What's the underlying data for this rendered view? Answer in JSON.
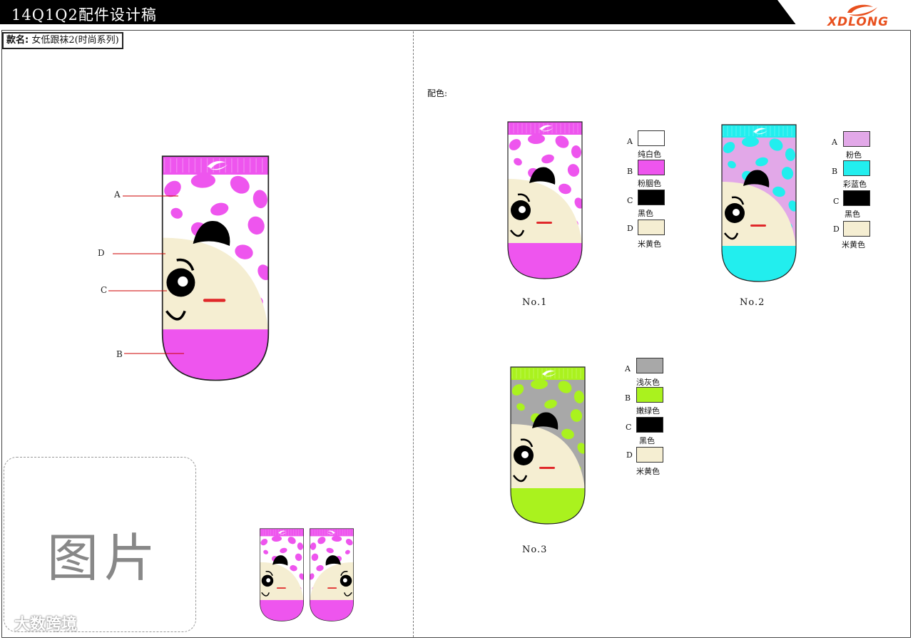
{
  "header": {
    "title": "14Q1Q2配件设计稿",
    "logo_text": "XDLONG",
    "bar_color": "#000000",
    "logo_color": "#e8501e"
  },
  "style": {
    "label": "款名:",
    "name": "女低跟袜2(时尚系列)"
  },
  "main_sock": {
    "callouts": [
      "A",
      "D",
      "C",
      "B"
    ]
  },
  "photo": {
    "placeholder_text": "图片"
  },
  "watermark": "大数跨境",
  "palette": {
    "label": "配色:",
    "colorways": [
      {
        "number": "No.1",
        "swatches": [
          {
            "letter": "A",
            "name": "纯白色",
            "color": "#ffffff"
          },
          {
            "letter": "B",
            "name": "粉胭色",
            "color": "#ee55ee"
          },
          {
            "letter": "C",
            "name": "黑色",
            "color": "#000000"
          },
          {
            "letter": "D",
            "name": "米黄色",
            "color": "#f5eed2"
          }
        ]
      },
      {
        "number": "No.2",
        "swatches": [
          {
            "letter": "A",
            "name": "粉色",
            "color": "#e2a8e8"
          },
          {
            "letter": "B",
            "name": "彩蓝色",
            "color": "#22eeee"
          },
          {
            "letter": "C",
            "name": "黑色",
            "color": "#000000"
          },
          {
            "letter": "D",
            "name": "米黄色",
            "color": "#f5eed2"
          }
        ]
      },
      {
        "number": "No.3",
        "swatches": [
          {
            "letter": "A",
            "name": "浅灰色",
            "color": "#a8a8a8"
          },
          {
            "letter": "B",
            "name": "嫩绿色",
            "color": "#aaf21e"
          },
          {
            "letter": "C",
            "name": "黑色",
            "color": "#000000"
          },
          {
            "letter": "D",
            "name": "米黄色",
            "color": "#f5eed2"
          }
        ]
      }
    ]
  }
}
